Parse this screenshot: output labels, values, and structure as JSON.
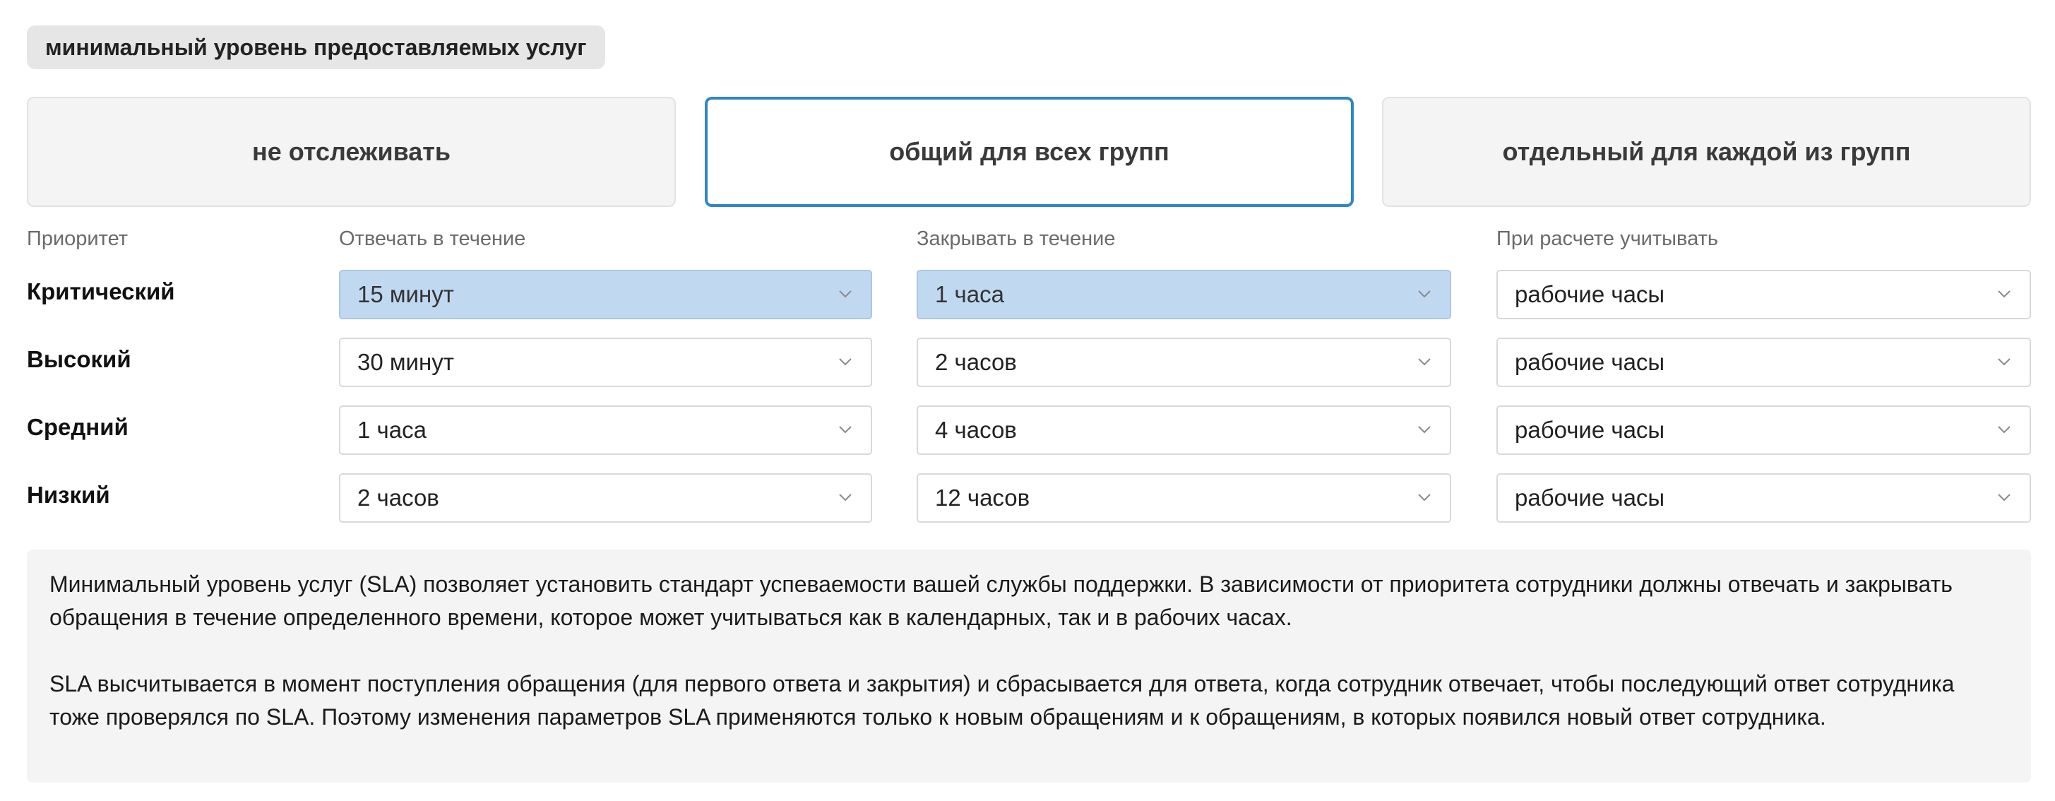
{
  "section_title": "минимальный уровень предоставляемых услуг",
  "modes": [
    {
      "label": "не отслеживать",
      "selected": false
    },
    {
      "label": "общий для всех групп",
      "selected": true
    },
    {
      "label": "отдельный для каждой из групп",
      "selected": false
    }
  ],
  "columns": {
    "priority": "Приоритет",
    "respond": "Отвечать в течение",
    "close": "Закрывать в течение",
    "calc": "При расчете учитывать"
  },
  "rows": [
    {
      "priority": "Критический",
      "respond": "15 минут",
      "close": "1 часа",
      "calc": "рабочие часы"
    },
    {
      "priority": "Высокий",
      "respond": "30 минут",
      "close": "2 часов",
      "calc": "рабочие часы"
    },
    {
      "priority": "Средний",
      "respond": "1 часа",
      "close": "4 часов",
      "calc": "рабочие часы"
    },
    {
      "priority": "Низкий",
      "respond": "2 часов",
      "close": "12 часов",
      "calc": "рабочие часы"
    }
  ],
  "info": {
    "paragraph1": "Минимальный уровень услуг (SLA) позволяет установить стандарт успеваемости вашей службы поддержки. В зависимости от приоритета сотрудники должны отвечать и закрывать обращения в течение определенного времени, которое может учитываться как в календарных, так и в рабочих часах.",
    "paragraph2": "SLA высчитывается в момент поступления обращения (для первого ответа и закрытия) и сбрасывается для ответа, когда сотрудник отвечает, чтобы последующий ответ сотрудника тоже проверялся по SLA. Поэтому изменения параметров SLA применяются только к новым обращениям и к обращениям, в которых появился новый ответ сотрудника."
  },
  "colors": {
    "selected_border": "#2f86c9",
    "highlight_field": "#c0d9f0",
    "panel_bg": "#f4f4f4"
  },
  "icons": {
    "select_arrow": "chevron-down-icon"
  }
}
